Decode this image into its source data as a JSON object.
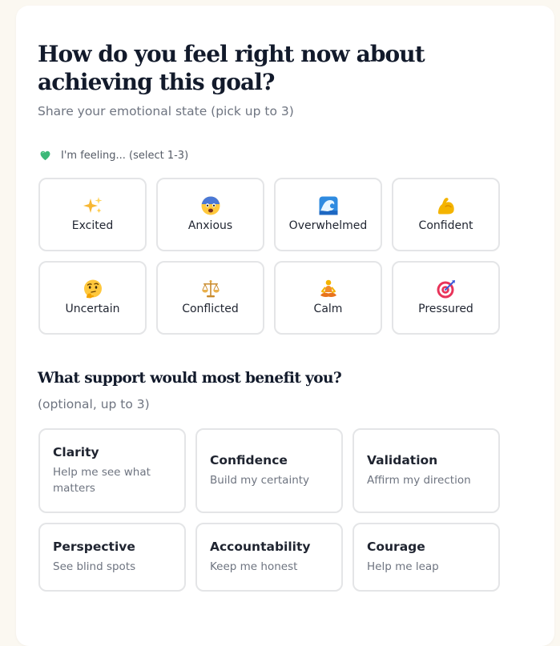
{
  "question": {
    "title": "How do you feel right now about achieving this goal?",
    "subtitle": "Share your emotional state (pick up to 3)"
  },
  "feeling": {
    "label": "I'm feeling... (select 1-3)",
    "heart_color": "#3cb878",
    "options": [
      {
        "label": "Excited",
        "icon": "sparkles-icon"
      },
      {
        "label": "Anxious",
        "icon": "anxious-face-icon"
      },
      {
        "label": "Overwhelmed",
        "icon": "wave-icon"
      },
      {
        "label": "Confident",
        "icon": "flexed-biceps-icon"
      },
      {
        "label": "Uncertain",
        "icon": "thinking-face-icon"
      },
      {
        "label": "Conflicted",
        "icon": "scales-icon"
      },
      {
        "label": "Calm",
        "icon": "meditation-icon"
      },
      {
        "label": "Pressured",
        "icon": "target-icon"
      }
    ]
  },
  "support": {
    "title": "What support would most benefit you?",
    "subtitle": "(optional, up to 3)",
    "options": [
      {
        "title": "Clarity",
        "desc": "Help me see what matters"
      },
      {
        "title": "Confidence",
        "desc": "Build my certainty"
      },
      {
        "title": "Validation",
        "desc": "Affirm my direction"
      },
      {
        "title": "Perspective",
        "desc": "See blind spots"
      },
      {
        "title": "Accountability",
        "desc": "Keep me honest"
      },
      {
        "title": "Courage",
        "desc": "Help me leap"
      }
    ]
  }
}
